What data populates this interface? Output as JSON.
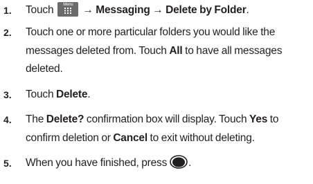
{
  "steps": [
    {
      "number": "1.",
      "touch": "Touch",
      "menu_key_label": "Menu",
      "arrow1": "→",
      "messaging": "Messaging",
      "arrow2": "→",
      "delete_by_folder": "Delete by Folder",
      "end": "."
    },
    {
      "number": "2.",
      "text_a": "Touch one or more particular folders you would like the messages deleted from. Touch ",
      "all": "All",
      "text_b": " to have all messages deleted."
    },
    {
      "number": "3.",
      "touch": "Touch ",
      "delete": "Delete",
      "end": "."
    },
    {
      "number": "4.",
      "text_a": "The ",
      "delete_q": "Delete?",
      "text_b": " confirmation box will display. Touch ",
      "yes": "Yes",
      "text_c": " to confirm deletion or ",
      "cancel": "Cancel",
      "text_d": " to exit without deleting."
    },
    {
      "number": "5.",
      "text_a": "When you have finished, press",
      "end": "."
    }
  ],
  "icons": {
    "menu_key": "menu-key-icon",
    "home_key": "home-key-icon"
  },
  "colors": {
    "text": "#231f20",
    "menu_key_bg": "#6b6b6b"
  }
}
